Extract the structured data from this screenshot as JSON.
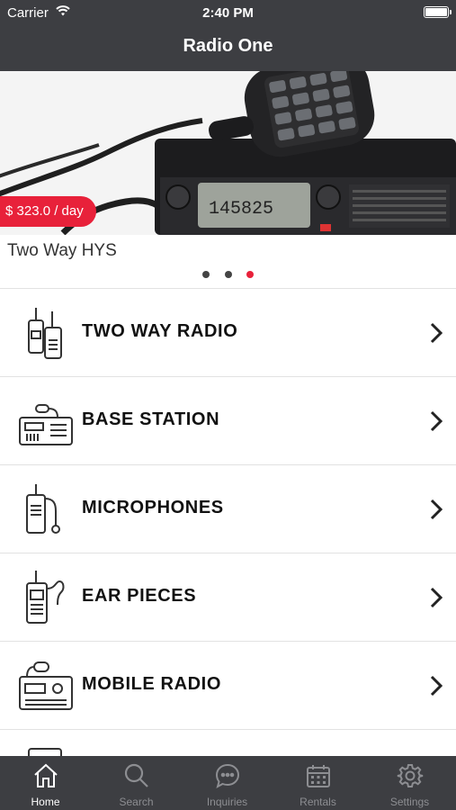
{
  "status_bar": {
    "carrier": "Carrier",
    "time": "2:40 PM"
  },
  "nav": {
    "title": "Radio One"
  },
  "carousel": {
    "price": "$ 323.0 / day",
    "title": "Two Way HYS",
    "page_count": 3,
    "active_page": 3
  },
  "categories": [
    {
      "label": "TWO WAY RADIO",
      "icon": "walkie-talkie-icon"
    },
    {
      "label": "BASE STATION",
      "icon": "base-station-icon"
    },
    {
      "label": "MICROPHONES",
      "icon": "microphone-icon"
    },
    {
      "label": "EAR PIECES",
      "icon": "ear-piece-icon"
    },
    {
      "label": "MOBILE RADIO",
      "icon": "mobile-radio-icon"
    }
  ],
  "tabbar": {
    "active": "Home",
    "items": [
      {
        "label": "Home",
        "icon": "home-icon"
      },
      {
        "label": "Search",
        "icon": "search-icon"
      },
      {
        "label": "Inquiries",
        "icon": "chat-bubble-icon"
      },
      {
        "label": "Rentals",
        "icon": "calendar-icon"
      },
      {
        "label": "Settings",
        "icon": "gear-icon"
      }
    ]
  },
  "colors": {
    "bar_background": "#3d3e42",
    "accent": "#e8213a",
    "tab_inactive": "#8d8e92"
  }
}
